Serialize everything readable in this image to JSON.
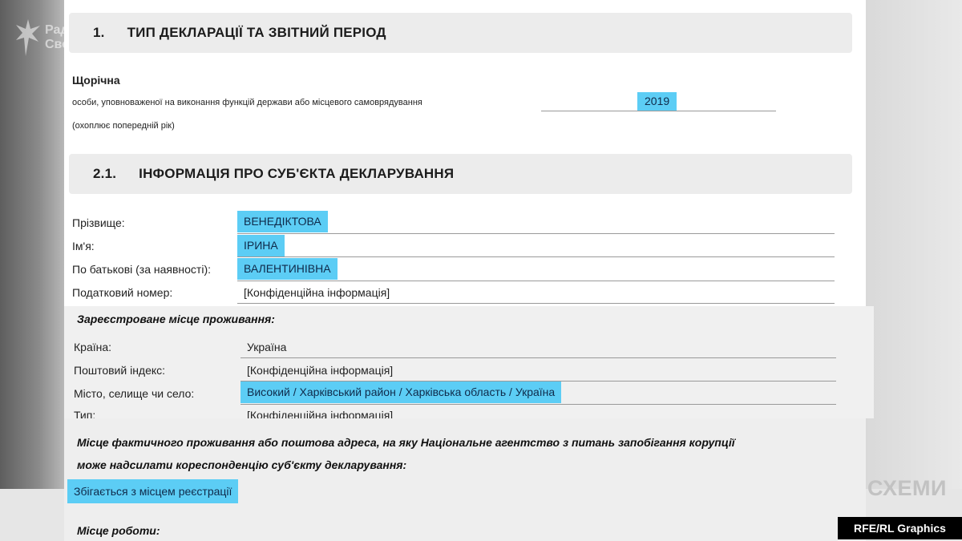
{
  "section1": {
    "number": "1.",
    "title": "ТИП ДЕКЛАРАЦІЇ ТА ЗВІТНИЙ ПЕРІОД",
    "annual": "Щорічна",
    "person_desc": "особи, уповноваженої на виконання функцій держави або місцевого самоврядування",
    "covers": "(охоплює попередній рік)",
    "year": "2019"
  },
  "section2": {
    "number": "2.1.",
    "title": "ІНФОРМАЦІЯ ПРО СУБ'ЄКТА ДЕКЛАРУВАННЯ",
    "fields": [
      {
        "label": "Прізвище:",
        "value": "ВЕНЕДІКТОВА"
      },
      {
        "label": "Ім'я:",
        "value": "ІРИНА"
      },
      {
        "label": "По батькові (за наявності):",
        "value": "ВАЛЕНТИНІВНА"
      },
      {
        "label": "Податковий номер:",
        "value": "[Конфіденційна інформація]"
      }
    ]
  },
  "registered": {
    "title": "Зареєстроване місце проживання:",
    "fields": [
      {
        "label": "Країна:",
        "value": "Україна"
      },
      {
        "label": "Поштовий індекс:",
        "value": "[Конфіденційна інформація]"
      },
      {
        "label": "Місто, селище чи село:",
        "value": "Високий / Харківський район / Харківська область / Україна"
      },
      {
        "label": "Тип:",
        "value": "[Конфіденційна інформація]"
      }
    ]
  },
  "actual": {
    "title_line1": "Місце фактичного проживання або поштова адреса, на яку Національне агентство з питань запобігання корупції",
    "title_line2": "може надсилати кореспонденцію суб'єкту декларування:",
    "value": "Збігається з місцем реєстрації"
  },
  "work": {
    "title": "Місце роботи:"
  },
  "watermark": {
    "line1": "Радіо",
    "line2": "Свобода"
  },
  "brand": "СХЕМИ",
  "credit": "RFE/RL Graphics",
  "colors": {
    "highlight": "#5ccdf5",
    "header_bg": "#ececec"
  }
}
